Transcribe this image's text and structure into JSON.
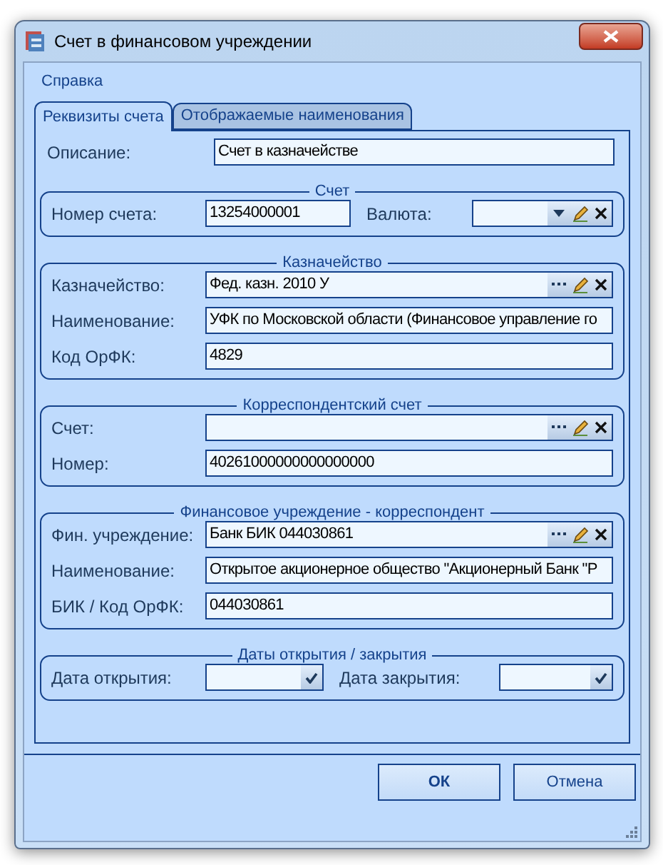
{
  "window": {
    "title": "Счет в финансовом учреждении"
  },
  "menu": [
    "Справка"
  ],
  "tabs": [
    {
      "label": "Реквизиты счета",
      "selected": true
    },
    {
      "label": "Отображаемые наименования",
      "selected": false
    }
  ],
  "description": {
    "label": "Описание:",
    "value": "Счет в казначействе"
  },
  "groups": [
    {
      "title": "Счет",
      "rows": [
        [
          {
            "label": "Номер счета:",
            "value": "13254000001",
            "kind": "text"
          },
          {
            "label": "Валюта:",
            "kind": "combo"
          }
        ]
      ]
    },
    {
      "title": "Казначейство",
      "rows": [
        [
          {
            "label": "Казначейство:",
            "value": "Фед. казн. 2010 У",
            "kind": "lookup"
          }
        ],
        [
          {
            "label": "Наименование:",
            "value": "УФК по Московской области (Финансовое управление го",
            "kind": "text"
          }
        ],
        [
          {
            "label": "Код ОрФК:",
            "value": "4829",
            "kind": "text"
          }
        ]
      ]
    },
    {
      "title": "Корреспондентский счет",
      "rows": [
        [
          {
            "label": "Счет:",
            "kind": "lookup"
          }
        ],
        [
          {
            "label": "Номер:",
            "value": "40261000000000000000",
            "kind": "text"
          }
        ]
      ]
    },
    {
      "title": "Финансовое учреждение - корреспондент",
      "rows": [
        [
          {
            "label": "Фин. учреждение:",
            "value": "Банк БИК 044030861",
            "kind": "lookup"
          }
        ],
        [
          {
            "label": "Наименование:",
            "value": "Открытое акционерное общество \"Акционерный Банк \"Р",
            "kind": "text"
          }
        ],
        [
          {
            "label": "БИК / Код ОрФК:",
            "value": "044030861",
            "kind": "text"
          }
        ]
      ]
    },
    {
      "title": "Даты открытия / закрытия",
      "rows": [
        [
          {
            "label": "Дата открытия:",
            "kind": "date"
          },
          {
            "label": "Дата закрытия:",
            "kind": "date"
          }
        ]
      ]
    }
  ],
  "buttons": [
    {
      "label": "ОК",
      "default": true
    },
    {
      "label": "Отмена",
      "default": false
    }
  ]
}
